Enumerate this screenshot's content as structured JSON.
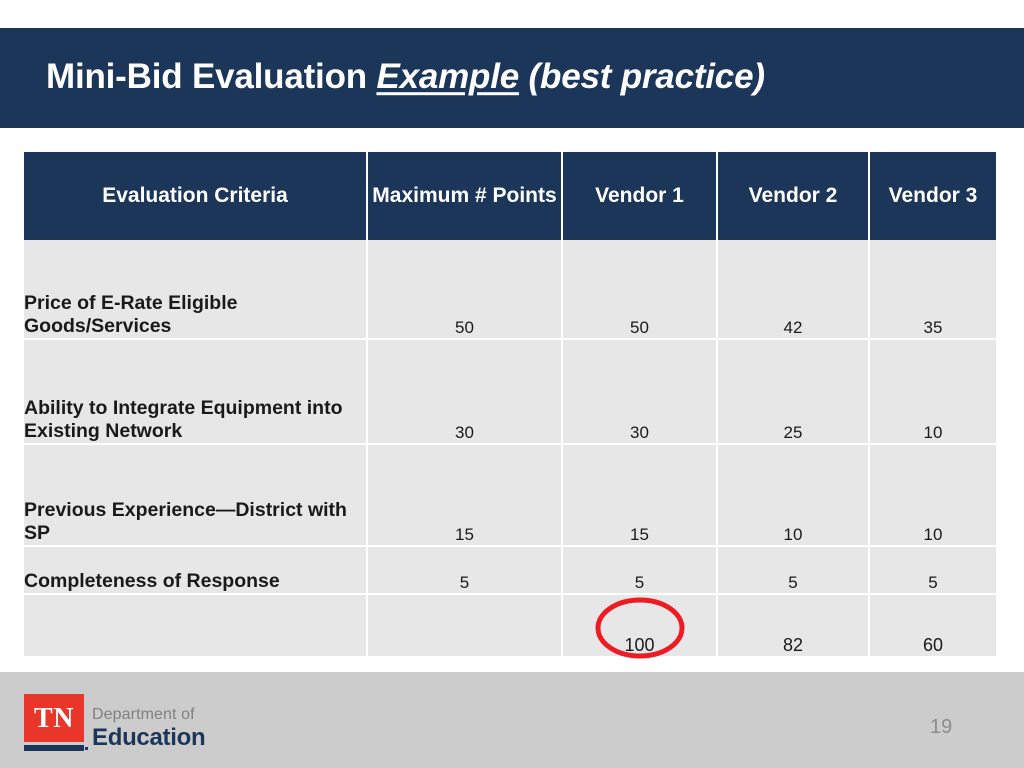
{
  "slide": {
    "title_prefix": "Mini-Bid Evaluation ",
    "title_emphasis": "Example",
    "title_suffix": " (best practice)",
    "page_number": "19",
    "colors": {
      "navy": "#1c3659",
      "table_cell": "#e7e7e7",
      "footer_band": "#cccccc",
      "highlight_red": "#ed1c24",
      "logo_red": "#e8372a"
    }
  },
  "table": {
    "columns": [
      "Evaluation Criteria",
      "Maximum # Points",
      "Vendor 1",
      "Vendor 2",
      "Vendor 3"
    ],
    "rows": [
      {
        "criteria": "Price of E-Rate Eligible Goods/Services",
        "max_points": "50",
        "vendor_1": "50",
        "vendor_2": "42",
        "vendor_3": "35"
      },
      {
        "criteria": "Ability to Integrate Equipment into Existing Network",
        "max_points": "30",
        "vendor_1": "30",
        "vendor_2": "25",
        "vendor_3": "10"
      },
      {
        "criteria": "Previous Experience—District with SP",
        "max_points": "15",
        "vendor_1": "15",
        "vendor_2": "10",
        "vendor_3": "10"
      },
      {
        "criteria": "Completeness of Response",
        "max_points": "5",
        "vendor_1": "5",
        "vendor_2": "5",
        "vendor_3": "5"
      },
      {
        "criteria": "",
        "max_points": "",
        "vendor_1": "100",
        "vendor_2": "82",
        "vendor_3": "60"
      }
    ]
  },
  "logo": {
    "mark": "TN",
    "line1": "Department of",
    "line2": "Education"
  }
}
